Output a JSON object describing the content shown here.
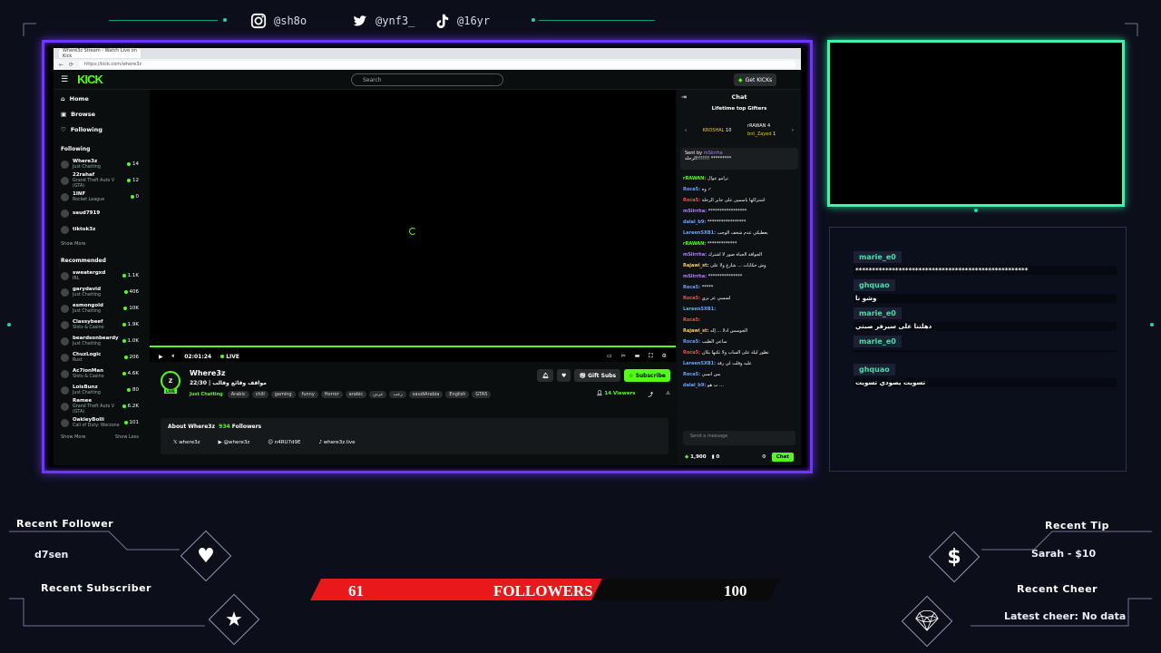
{
  "social": {
    "instagram": "@sh8o",
    "twitter": "@ynf3_",
    "tiktok": "@16yr"
  },
  "browser": {
    "tab_title": "Where3z Stream - Watch Live on Kick",
    "url": "https://kick.com/where3z"
  },
  "kick": {
    "logo": "KICK",
    "search_placeholder": "Search",
    "get_kicks": "Get KICKs",
    "nav": [
      "Home",
      "Browse",
      "Following"
    ],
    "following_header": "Following",
    "following": [
      {
        "name": "Where3z",
        "game": "Just Chatting",
        "viewers": "14"
      },
      {
        "name": "22rahaf",
        "game": "Grand Theft Auto V (GTA)",
        "viewers": "12"
      },
      {
        "name": "1INF",
        "game": "Rocket League",
        "viewers": "0"
      },
      {
        "name": "saud7919",
        "game": "",
        "viewers": ""
      },
      {
        "name": "tiktok3z",
        "game": "",
        "viewers": ""
      }
    ],
    "show_more": "Show More",
    "recommended_header": "Recommended",
    "recommended": [
      {
        "name": "sweatergxd",
        "game": "IRL",
        "viewers": "1.1K"
      },
      {
        "name": "garydavid",
        "game": "Just Chatting",
        "viewers": "406"
      },
      {
        "name": "esmongold",
        "game": "Just Chatting",
        "viewers": "10K"
      },
      {
        "name": "Classybeef",
        "game": "Slots & Casino",
        "viewers": "1.9K"
      },
      {
        "name": "beardsonbeardy",
        "game": "Just Chatting",
        "viewers": "1.0K"
      },
      {
        "name": "ChuzLogic",
        "game": "Rust",
        "viewers": "206"
      },
      {
        "name": "Ac7ionMan",
        "game": "Slots & Casino",
        "viewers": "4.6K"
      },
      {
        "name": "LoisBunz",
        "game": "Just Chatting",
        "viewers": "80"
      },
      {
        "name": "Ramee",
        "game": "Grand Theft Auto V (GTA)",
        "viewers": "6.2K"
      },
      {
        "name": "OakleyBolli",
        "game": "Call of Duty: Warzone",
        "viewers": "101"
      }
    ],
    "show_less": "Show Less",
    "player": {
      "time": "02:01:24",
      "live": "LIVE"
    },
    "streamer": {
      "name": "Where3z",
      "title": "22/30 | مواقف وقائع وقالب",
      "category": "Just Chatting",
      "tags": [
        "Arabic",
        "chill",
        "gaming",
        "funny",
        "Horror",
        "arabic",
        "عربي",
        "رعب",
        "saudiArabia",
        "English",
        "GTA5"
      ],
      "gift_subs": "Gift Subs",
      "subscribe": "Subscribe",
      "viewers": "14 Viewers"
    },
    "about": {
      "title": "About Where3z",
      "followers_count": "934",
      "followers_label": "Followers",
      "links": [
        "where3z",
        "@where3z",
        "n4RU7d9E",
        "where3z.live"
      ]
    },
    "chat": {
      "title": "Chat",
      "gifters_title": "Lifetime top Gifters",
      "top1": "KROSHAL",
      "top1_count": "10",
      "top2": "rRAWAN",
      "top2_count": "4",
      "top3": "bnt_Zayed",
      "top3_count": "1",
      "pinned_by": "Sent by",
      "pinned_user": "mSiirrha",
      "pinned_text": "الرحلة!!!!!!! *********",
      "messages": [
        {
          "user": "rRAWAN:",
          "text": "ترامو عوال",
          "color": "#53fc18"
        },
        {
          "user": "Roca5:",
          "text": "وه ✓",
          "color": "#66a3ff"
        },
        {
          "user": "Roca5:",
          "text": "اشتراكها ياسمين على جابر الرحلة",
          "color": "#ff4a4a"
        },
        {
          "user": "mSiirrha:",
          "text": "*****************",
          "color": "#b37dff"
        },
        {
          "user": "dalal_b9:",
          "text": "*****************",
          "color": "#66a3ff"
        },
        {
          "user": "LareenSXB1:",
          "text": "يعطيكي عدم شخف الوجب",
          "color": "#66a3ff"
        },
        {
          "user": "rRAWAN:",
          "text": "*************",
          "color": "#53fc18"
        },
        {
          "user": "mSiirrha:",
          "text": "الجوافة الحياة صور لا اشترك",
          "color": "#b37dff"
        },
        {
          "user": "Rajawi_st:",
          "text": "وش حكايات ... شارع ولا على",
          "color": "#ffcf4a"
        },
        {
          "user": "mSiirrha:",
          "text": "***************",
          "color": "#b37dff"
        },
        {
          "user": "Roca5:",
          "text": "*****",
          "color": "#66a3ff"
        },
        {
          "user": "Roca5:",
          "text": "لسسي عز بزي",
          "color": "#ff4a4a"
        },
        {
          "user": "LareenSXB1:",
          "text": "",
          "color": "#66a3ff"
        },
        {
          "user": "Roca5:",
          "text": "",
          "color": "#ff4a4a"
        },
        {
          "user": "Rajawi_st:",
          "text": "الجوسس ادلا ... إله",
          "color": "#ffcf4a"
        },
        {
          "user": "Roca5:",
          "text": "ساعي الطيب",
          "color": "#66a3ff"
        },
        {
          "user": "Roca5:",
          "text": "تطور ليلة على الساب ولا تكبها بكان",
          "color": "#ff4a4a"
        },
        {
          "user": "LareenSXB1:",
          "text": "عليه وقلت لي رقة",
          "color": "#66a3ff"
        },
        {
          "user": "Roca5:",
          "text": "بس انسي",
          "color": "#66a3ff"
        },
        {
          "user": "dalal_b9:",
          "text": "ب هو ...",
          "color": "#66a3ff"
        }
      ],
      "input_placeholder": "Send a message",
      "kicks": "1,900",
      "points": "0",
      "chat_button": "Chat"
    }
  },
  "overlay_chat": [
    {
      "user": "marie_e0",
      "text": "****************************************************"
    },
    {
      "user": "ghquao",
      "text": "وشو نا"
    },
    {
      "user": "marie_e0",
      "text": "دهلتنا على سيرفر صبتي"
    },
    {
      "user": "marie_e0",
      "text": ""
    },
    {
      "user": "ghquao",
      "text": "تسويت يصودي تسويت"
    }
  ],
  "recent": {
    "follower_label": "Recent Follower",
    "follower": "d7sen",
    "subscriber_label": "Recent Subscriber",
    "tip_label": "Recent Tip",
    "tip": "Sarah - $10",
    "cheer_label": "Recent Cheer",
    "cheer": "Latest cheer: No data"
  },
  "goal": {
    "current": "61",
    "label": "FOLLOWERS",
    "target": "100",
    "progress_fraction": 0.61
  },
  "colors": {
    "accent_green": "#53fc18",
    "frame_purple": "#6f35ff",
    "frame_mint": "#3ff5a8",
    "goal_red": "#e8191a"
  }
}
